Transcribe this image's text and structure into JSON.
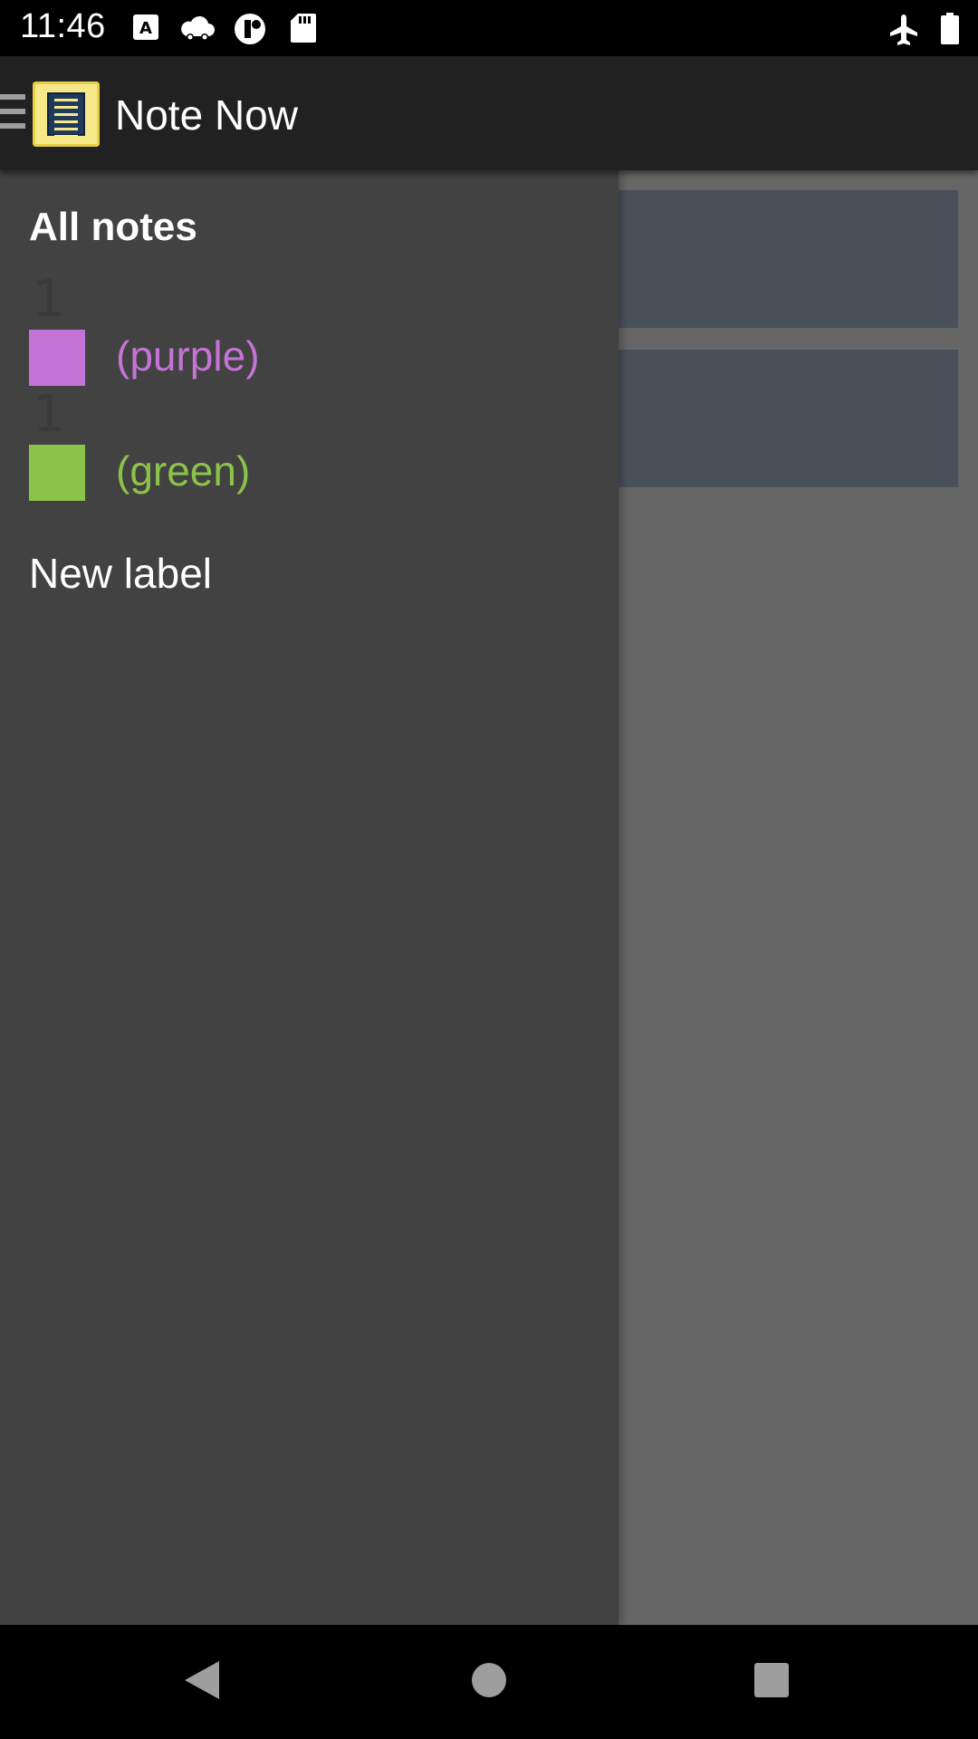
{
  "status_bar": {
    "time": "11:46",
    "icons": [
      "a-keyboard-icon",
      "cloud-icon",
      "circle-c-icon",
      "sd-card-icon",
      "airplane-icon",
      "battery-icon"
    ]
  },
  "app_bar": {
    "title": "Note Now",
    "menu_icon": "hamburger-icon",
    "logo_icon": "notes-app-icon"
  },
  "drawer": {
    "heading": "All notes",
    "labels": [
      {
        "count": "1",
        "name": "(purple)",
        "color": "#c474d6"
      },
      {
        "count": "1",
        "name": "(green)",
        "color": "#8bc34a"
      }
    ],
    "new_label": "New label"
  },
  "colors": {
    "app_bar": "#212121",
    "drawer": "#424242",
    "scrim": "#666666",
    "note_card": "#48505a"
  },
  "nav_bar": {
    "back_icon": "back-triangle-icon",
    "home_icon": "home-circle-icon",
    "recents_icon": "recents-square-icon"
  }
}
